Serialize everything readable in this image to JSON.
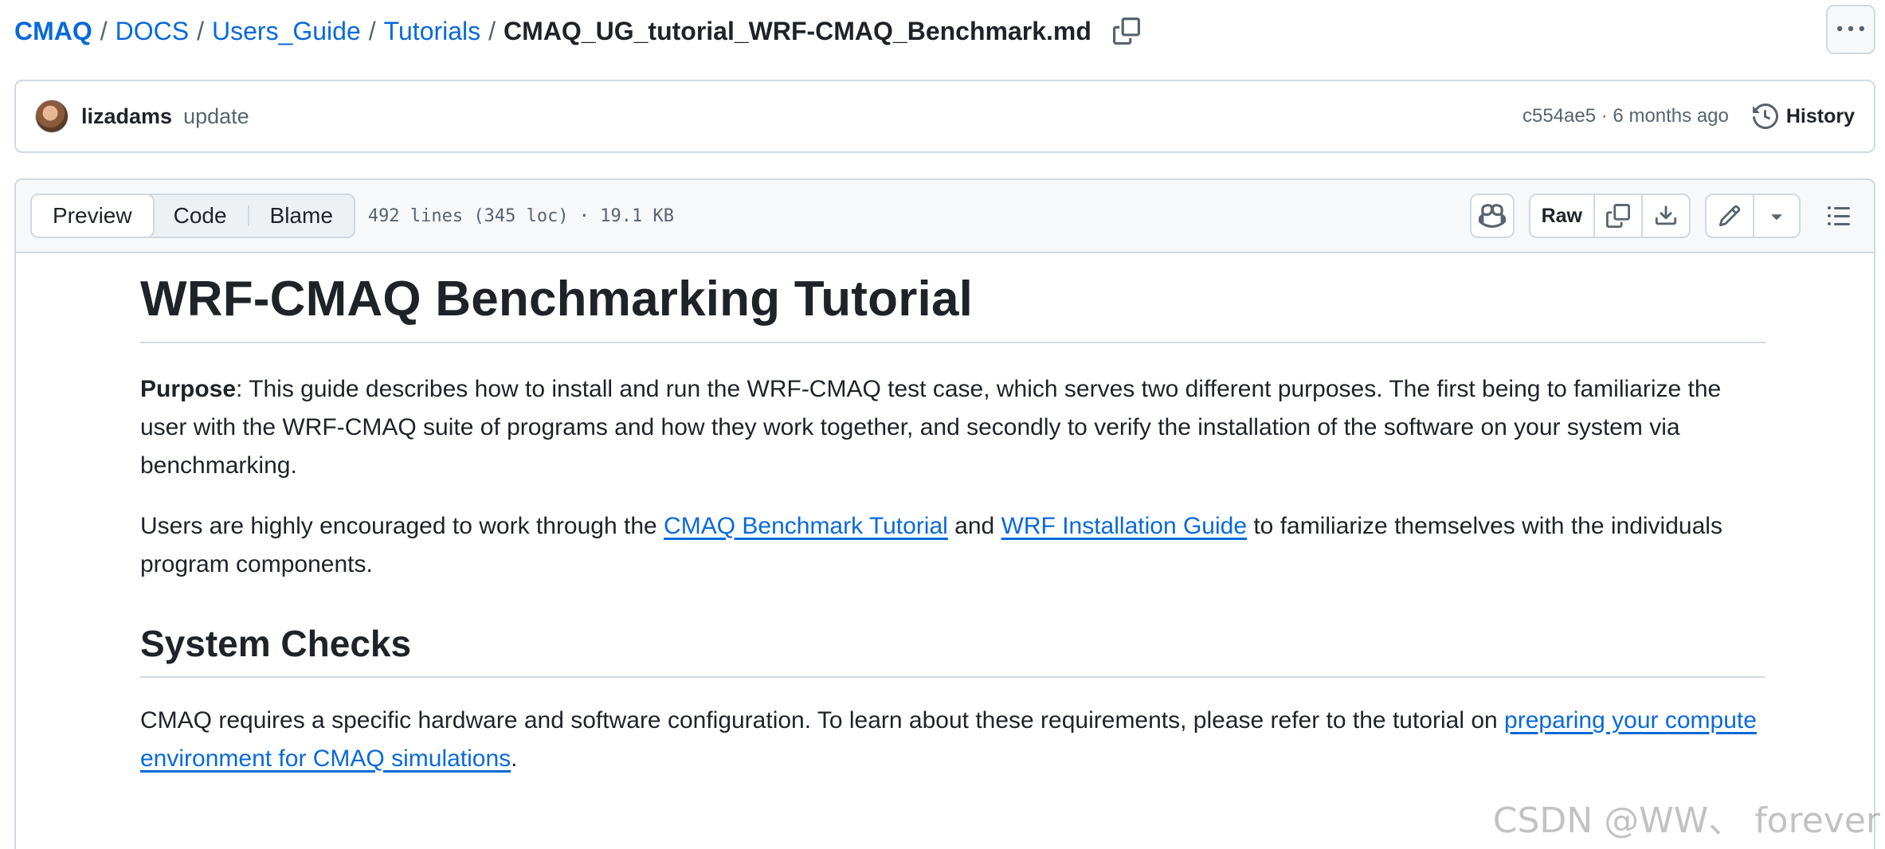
{
  "breadcrumb": {
    "items": [
      "CMAQ",
      "DOCS",
      "Users_Guide",
      "Tutorials"
    ],
    "separator": "/",
    "current": "CMAQ_UG_tutorial_WRF-CMAQ_Benchmark.md"
  },
  "commit": {
    "author": "lizadams",
    "message": "update",
    "meta": "c554ae5 · 6 months ago",
    "history_label": "History"
  },
  "file_header": {
    "tabs": [
      "Preview",
      "Code",
      "Blame"
    ],
    "active_tab": "Preview",
    "info": "492 lines (345 loc) · 19.1 KB",
    "raw_label": "Raw"
  },
  "content": {
    "h1": "WRF-CMAQ Benchmarking Tutorial",
    "p1_bold": "Purpose",
    "p1_text": ": This guide describes how to install and run the WRF-CMAQ test case, which serves two different purposes. The first being to familiarize the user with the WRF-CMAQ suite of programs and how they work together, and secondly to verify the installation of the software on your system via benchmarking.",
    "p2_pre": "Users are highly encouraged to work through the ",
    "p2_link1": "CMAQ Benchmark Tutorial",
    "p2_mid": " and ",
    "p2_link2": "WRF Installation Guide",
    "p2_post": " to familiarize themselves with the individuals program components.",
    "h2": "System Checks",
    "p3_pre": "CMAQ requires a specific hardware and software configuration. To learn about these requirements, please refer to the tutorial on ",
    "p3_link": "preparing your compute environment for CMAQ simulations",
    "p3_post": "."
  },
  "watermark": "CSDN @WW、 forever",
  "icons": {
    "copy": "copy-icon",
    "more": "kebab-horizontal-icon",
    "history": "history-clock-icon",
    "copilot": "copilot-icon",
    "download": "download-icon",
    "edit": "pencil-icon",
    "dropdown": "triangle-down-icon",
    "toc": "list-unordered-icon"
  },
  "colors": {
    "link": "#0969da",
    "text": "#1f2328",
    "muted": "#59636e",
    "border": "#d1d9e0",
    "header_bg": "#f6f8fa"
  }
}
